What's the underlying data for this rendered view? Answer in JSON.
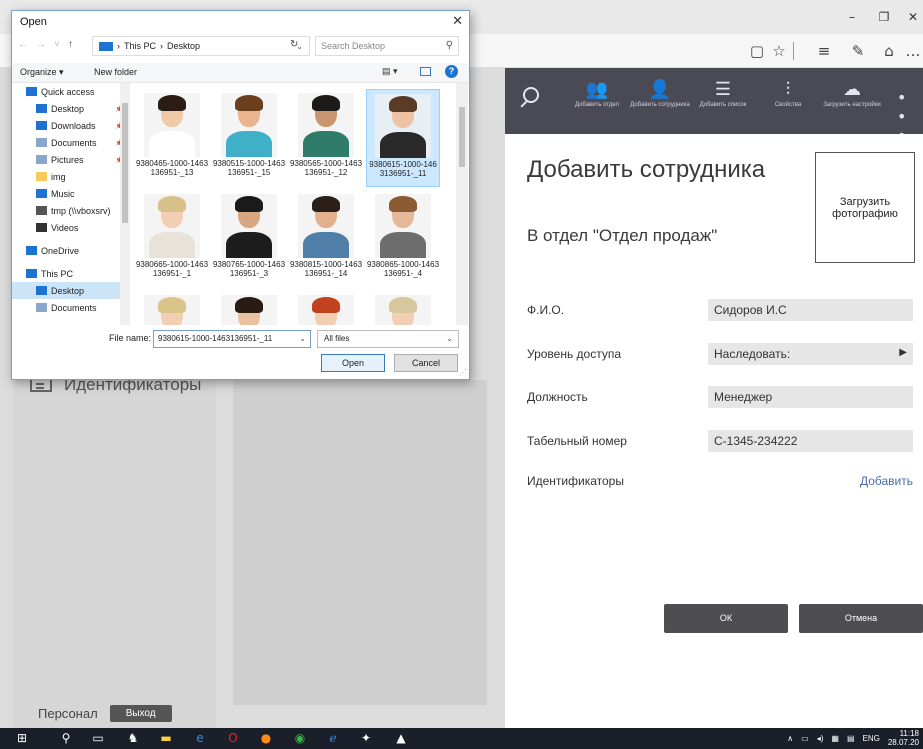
{
  "browser": {
    "minimize": "–",
    "restore": "❐",
    "close": "✕",
    "reading_view": "▢",
    "favorite": "☆",
    "hub": "≡",
    "notes": "✎",
    "share": "⌂",
    "more": "…"
  },
  "app": {
    "toolbar": [
      {
        "label": "Добавить отдел",
        "icon": "add-department-icon"
      },
      {
        "label": "Добавить сотрудника",
        "icon": "add-employee-icon"
      },
      {
        "label": "Добавить список",
        "icon": "add-list-icon"
      },
      {
        "label": "Свойства",
        "icon": "properties-icon"
      },
      {
        "label": "Загрузить настройки",
        "icon": "upload-settings-icon"
      }
    ],
    "more": "• • •",
    "left_nav_item": "Идентификаторы",
    "personal_label": "Персонал",
    "exit_label": "Выход",
    "form": {
      "title": "Добавить сотрудника",
      "department": "В отдел \"Отдел продаж\"",
      "upload_photo": "Загрузить фотографию",
      "rows": [
        {
          "label": "Ф.И.О.",
          "value": "Сидоров И.С"
        },
        {
          "label": "Уровень доступа",
          "value": "Наследовать:"
        },
        {
          "label": "Должность",
          "value": "Менеджер"
        },
        {
          "label": "Табельный номер",
          "value": "С-1345-234222"
        },
        {
          "label": "Идентификаторы",
          "value": ""
        }
      ],
      "add_link": "Добавить",
      "ok": "ОК",
      "cancel": "Отмена"
    }
  },
  "dialog": {
    "title": "Open",
    "close": "✕",
    "address": [
      "This PC",
      "Desktop"
    ],
    "address_sep": "›",
    "search_placeholder": "Search Desktop",
    "organize": "Organize ▾",
    "new_folder": "New folder",
    "view": "▤ ▾",
    "help": "?",
    "tree": [
      {
        "label": "Quick access",
        "icon": "star-icon",
        "pin": false
      },
      {
        "label": "Desktop",
        "icon": "desktop-icon",
        "pin": true
      },
      {
        "label": "Downloads",
        "icon": "download-icon",
        "pin": true
      },
      {
        "label": "Documents",
        "icon": "documents-icon",
        "pin": true
      },
      {
        "label": "Pictures",
        "icon": "pictures-icon",
        "pin": true
      },
      {
        "label": "img",
        "icon": "folder-icon",
        "pin": false
      },
      {
        "label": "Music",
        "icon": "music-icon",
        "pin": false
      },
      {
        "label": "tmp (\\\\vboxsrv)",
        "icon": "network-drive-icon",
        "pin": false
      },
      {
        "label": "Videos",
        "icon": "videos-icon",
        "pin": false
      },
      {
        "label": "OneDrive",
        "icon": "onedrive-icon",
        "pin": false
      },
      {
        "label": "This PC",
        "icon": "pc-icon",
        "pin": false
      },
      {
        "label": "Desktop",
        "icon": "desktop-icon",
        "pin": false
      },
      {
        "label": "Documents",
        "icon": "documents-icon",
        "pin": false
      }
    ],
    "files": [
      {
        "name": "9380465-1000-1463136951-_13"
      },
      {
        "name": "9380515-1000-1463136951-_15"
      },
      {
        "name": "9380565-1000-1463136951-_12"
      },
      {
        "name": "9380615-1000-1463136951-_11"
      },
      {
        "name": "9380665-1000-1463136951-_1"
      },
      {
        "name": "9380765-1000-1463136951-_3"
      },
      {
        "name": "9380815-1000-1463136951-_14"
      },
      {
        "name": "9380865-1000-1463136951-_4"
      },
      {
        "name": ""
      },
      {
        "name": ""
      },
      {
        "name": ""
      },
      {
        "name": ""
      }
    ],
    "file_name_label": "File name:",
    "file_name_value": "9380615-1000-1463136951-_11",
    "file_type": "All files",
    "open": "Open",
    "cancel": "Cancel"
  },
  "taskbar": {
    "lang": "ENG",
    "time": "11:18",
    "date": "28.07.20"
  }
}
